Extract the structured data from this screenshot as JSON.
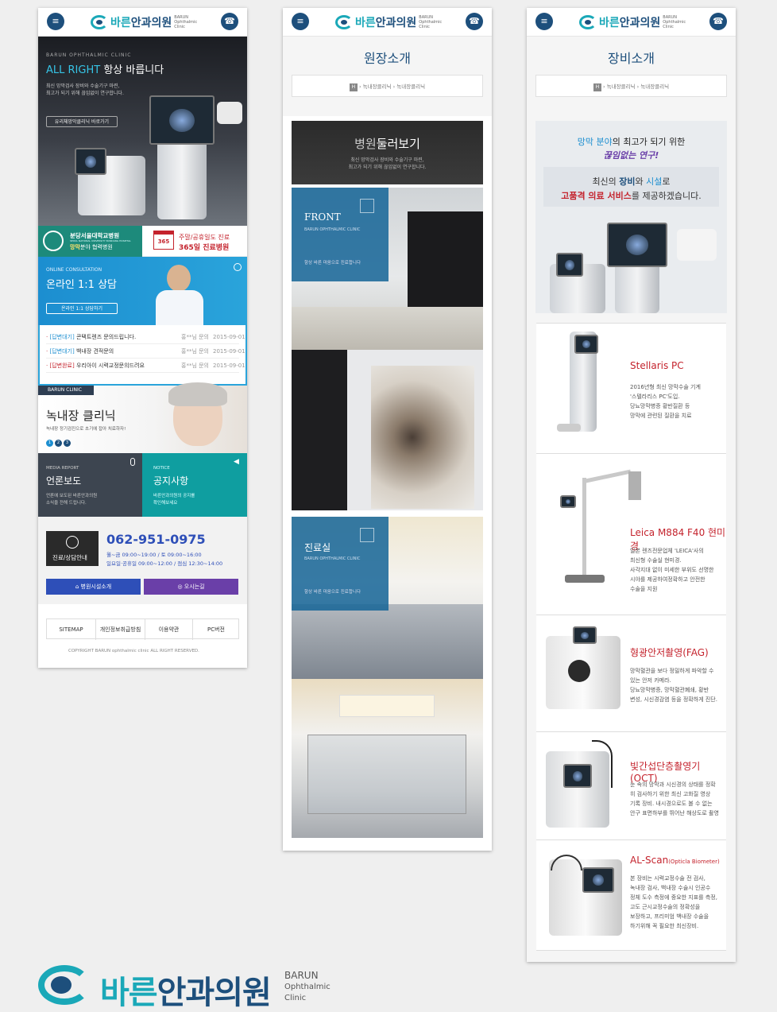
{
  "logo": {
    "text_a": "바른",
    "text_b": "안과의원",
    "en": "BARUN Ophthalmic Clinic"
  },
  "menu_icon": "hamburger-icon",
  "phone_icon": "phone-icon",
  "colors": {
    "brand_blue": "#1d4f7c",
    "brand_teal": "#1aa8b8",
    "red": "#c4232d",
    "purple": "#6a3fa8",
    "teal_tile": "#0f9ea0"
  },
  "screen1": {
    "hero": {
      "kicker": "BARUN OPHTHALMIC CLINIC",
      "title_accent": "ALL RIGHT",
      "title": "항상 바릅니다",
      "desc1": "최신 망막검사 장비와 수술기구 마련,",
      "desc2": "최고가 되기 위해 끊임없이 연구합니다.",
      "button": "유리체망막클리닉 바로가기"
    },
    "banners": {
      "partner_line1": "분당서울대학교병원",
      "partner_sub": "SEOUL NATIONAL UNIVERSITY BUNDANG HOSPITAL",
      "partner_line2a": "망막",
      "partner_line2b": "분야 협력병원",
      "calendar": "365",
      "weekend_line1": "주말/공휴일도 진료",
      "weekend_line2": "365일 진료병원"
    },
    "consult": {
      "kicker": "ONLINE CONSULTATION",
      "title": "온라인 1:1 상담",
      "button": "온라인 1:1 상담하기"
    },
    "notices": [
      {
        "tag": "[답변대기]",
        "title": "콘택트렌즈 문의드립니다.",
        "author": "홍**님 문의",
        "date": "2015-09-01"
      },
      {
        "tag": "[답변대기]",
        "title": "백내장 견적문의",
        "author": "홍**님 문의",
        "date": "2015-09-01"
      },
      {
        "tag": "[답변완료]",
        "title": "우리아이 시력교정문의드려요",
        "author": "홍**님 문의",
        "date": "2015-09-01"
      }
    ],
    "promo": {
      "tab": "BARUN CLINIC",
      "title": "녹내장 클리닉",
      "desc": "녹내장 정기검진으로 초기에 잡아 치료하자!",
      "dots": [
        "1",
        "2",
        "3"
      ]
    },
    "media": {
      "kicker": "MEDIA REPORT",
      "title": "언론보도",
      "desc1": "언론에 보도된 바른안과의원",
      "desc2": "소식을 전해 드립니다."
    },
    "notice": {
      "kicker": "NOTICE",
      "title": "공지사항",
      "desc1": "바른안과의원의 공지를",
      "desc2": "확인해보세요"
    },
    "contact": {
      "box": "진료/상담안내",
      "phone": "062-951-0975",
      "hours1": "월~금 09:00~19:00 / 토 09:00~16:00",
      "hours2": "일요일·공휴일 09:00~12:00 / 점심 12:30~14:00"
    },
    "buttons": {
      "facility": "병원시설소개",
      "map": "오시는길"
    },
    "footer": {
      "links": [
        "SITEMAP",
        "개인정보취급방침",
        "이용약관",
        "PC버전"
      ],
      "copyright": "COPYRIGHT BARUN ophthalmic clinic  ALL RIGHT RESERVED."
    }
  },
  "screen2": {
    "page_title": "원장소개",
    "breadcrumb": {
      "home": "H",
      "a": "녹내장클리닉",
      "b": "녹내장클리닉"
    },
    "tour": {
      "title_a": "병원",
      "title_b": "둘러보기",
      "desc1": "최신 망막검사 장비와 수술기구 마련,",
      "desc2": "최고가 되기 위해 끊임없이 연구합니다."
    },
    "front": {
      "title": "FRONT",
      "sub": "BARUN OPHTHALMIC CLINIC",
      "desc": "항상 바른 마음으로 진료합니다"
    },
    "exam": {
      "title": "진료실",
      "sub": "BARUN OPHTHALMIC CLINIC",
      "desc": "항상 바른 마음으로 진료합니다"
    }
  },
  "screen3": {
    "page_title": "장비소개",
    "breadcrumb": {
      "home": "H",
      "a": "녹내장클리닉",
      "b": "녹내장클리닉"
    },
    "intro": {
      "l1a": "망막 분야",
      "l1b": "의 최고가 되기 위한",
      "l2": "끊임없는 연구!",
      "l3a": "최신의 ",
      "l3b": "장비",
      "l3c": "와 ",
      "l3d": "시설",
      "l3e": "로",
      "l4a": "고품격 의료 서비스",
      "l4b": "를 제공하겠습니다."
    },
    "equipment": [
      {
        "name": "Stellaris PC",
        "desc": [
          "2016년형 최신 망막수술 기계",
          "'스텔라리스 PC'도입.",
          "당뇨망막병증 황반질환 등",
          "망막에 관련된 질환을 치료"
        ]
      },
      {
        "name": "Leica M884 F40 현미경",
        "desc": [
          "일본 렌즈전문업체 'LEICA'사의",
          "최신형 수술실 현미경.",
          "사각지대 없이 미세한 부위도 선명한",
          "시야를 제공하여정확하고 안전한",
          "수술을 지원"
        ]
      },
      {
        "name": "형광안저촬영(FAG)",
        "desc": [
          "망막혈관을 보다 정밀하게 파악할 수",
          "있는 안저 카메라.",
          "당뇨망막병증, 망막혈관폐쇄, 황반",
          "변성, 시신경감염 등을 정확하게 진단."
        ]
      },
      {
        "name": "빛간섭단층촬영기(OCT)",
        "desc": [
          "눈 속의 망막과 시신경의 상태를 정확",
          "히 검사하기 위한 최신 고화질 영상",
          "기록 장비. 내시경으로도 볼 수 없는",
          "안구 표면하부를 뛰어난 해상도로 촬영"
        ]
      },
      {
        "name": "AL-Scan",
        "name_sub": "(Opticla Biometer)",
        "desc": [
          "본 장비는 시력교정수술 전 검사,",
          "녹내장 검사, 백내장 수술시 인공수",
          "정체 도수 측정에 중요한 지표를 측정,",
          "고도 근시교정수술의 정확성을",
          "보장하고, 프리미엄 백내장 수술을",
          "하기위해 꼭 필요한 최신장비."
        ]
      }
    ]
  },
  "bottom_logo": {
    "a": "바른",
    "b": "안과의원",
    "en1": "BARUN",
    "en2": "Ophthalmic",
    "en3": "Clinic"
  }
}
